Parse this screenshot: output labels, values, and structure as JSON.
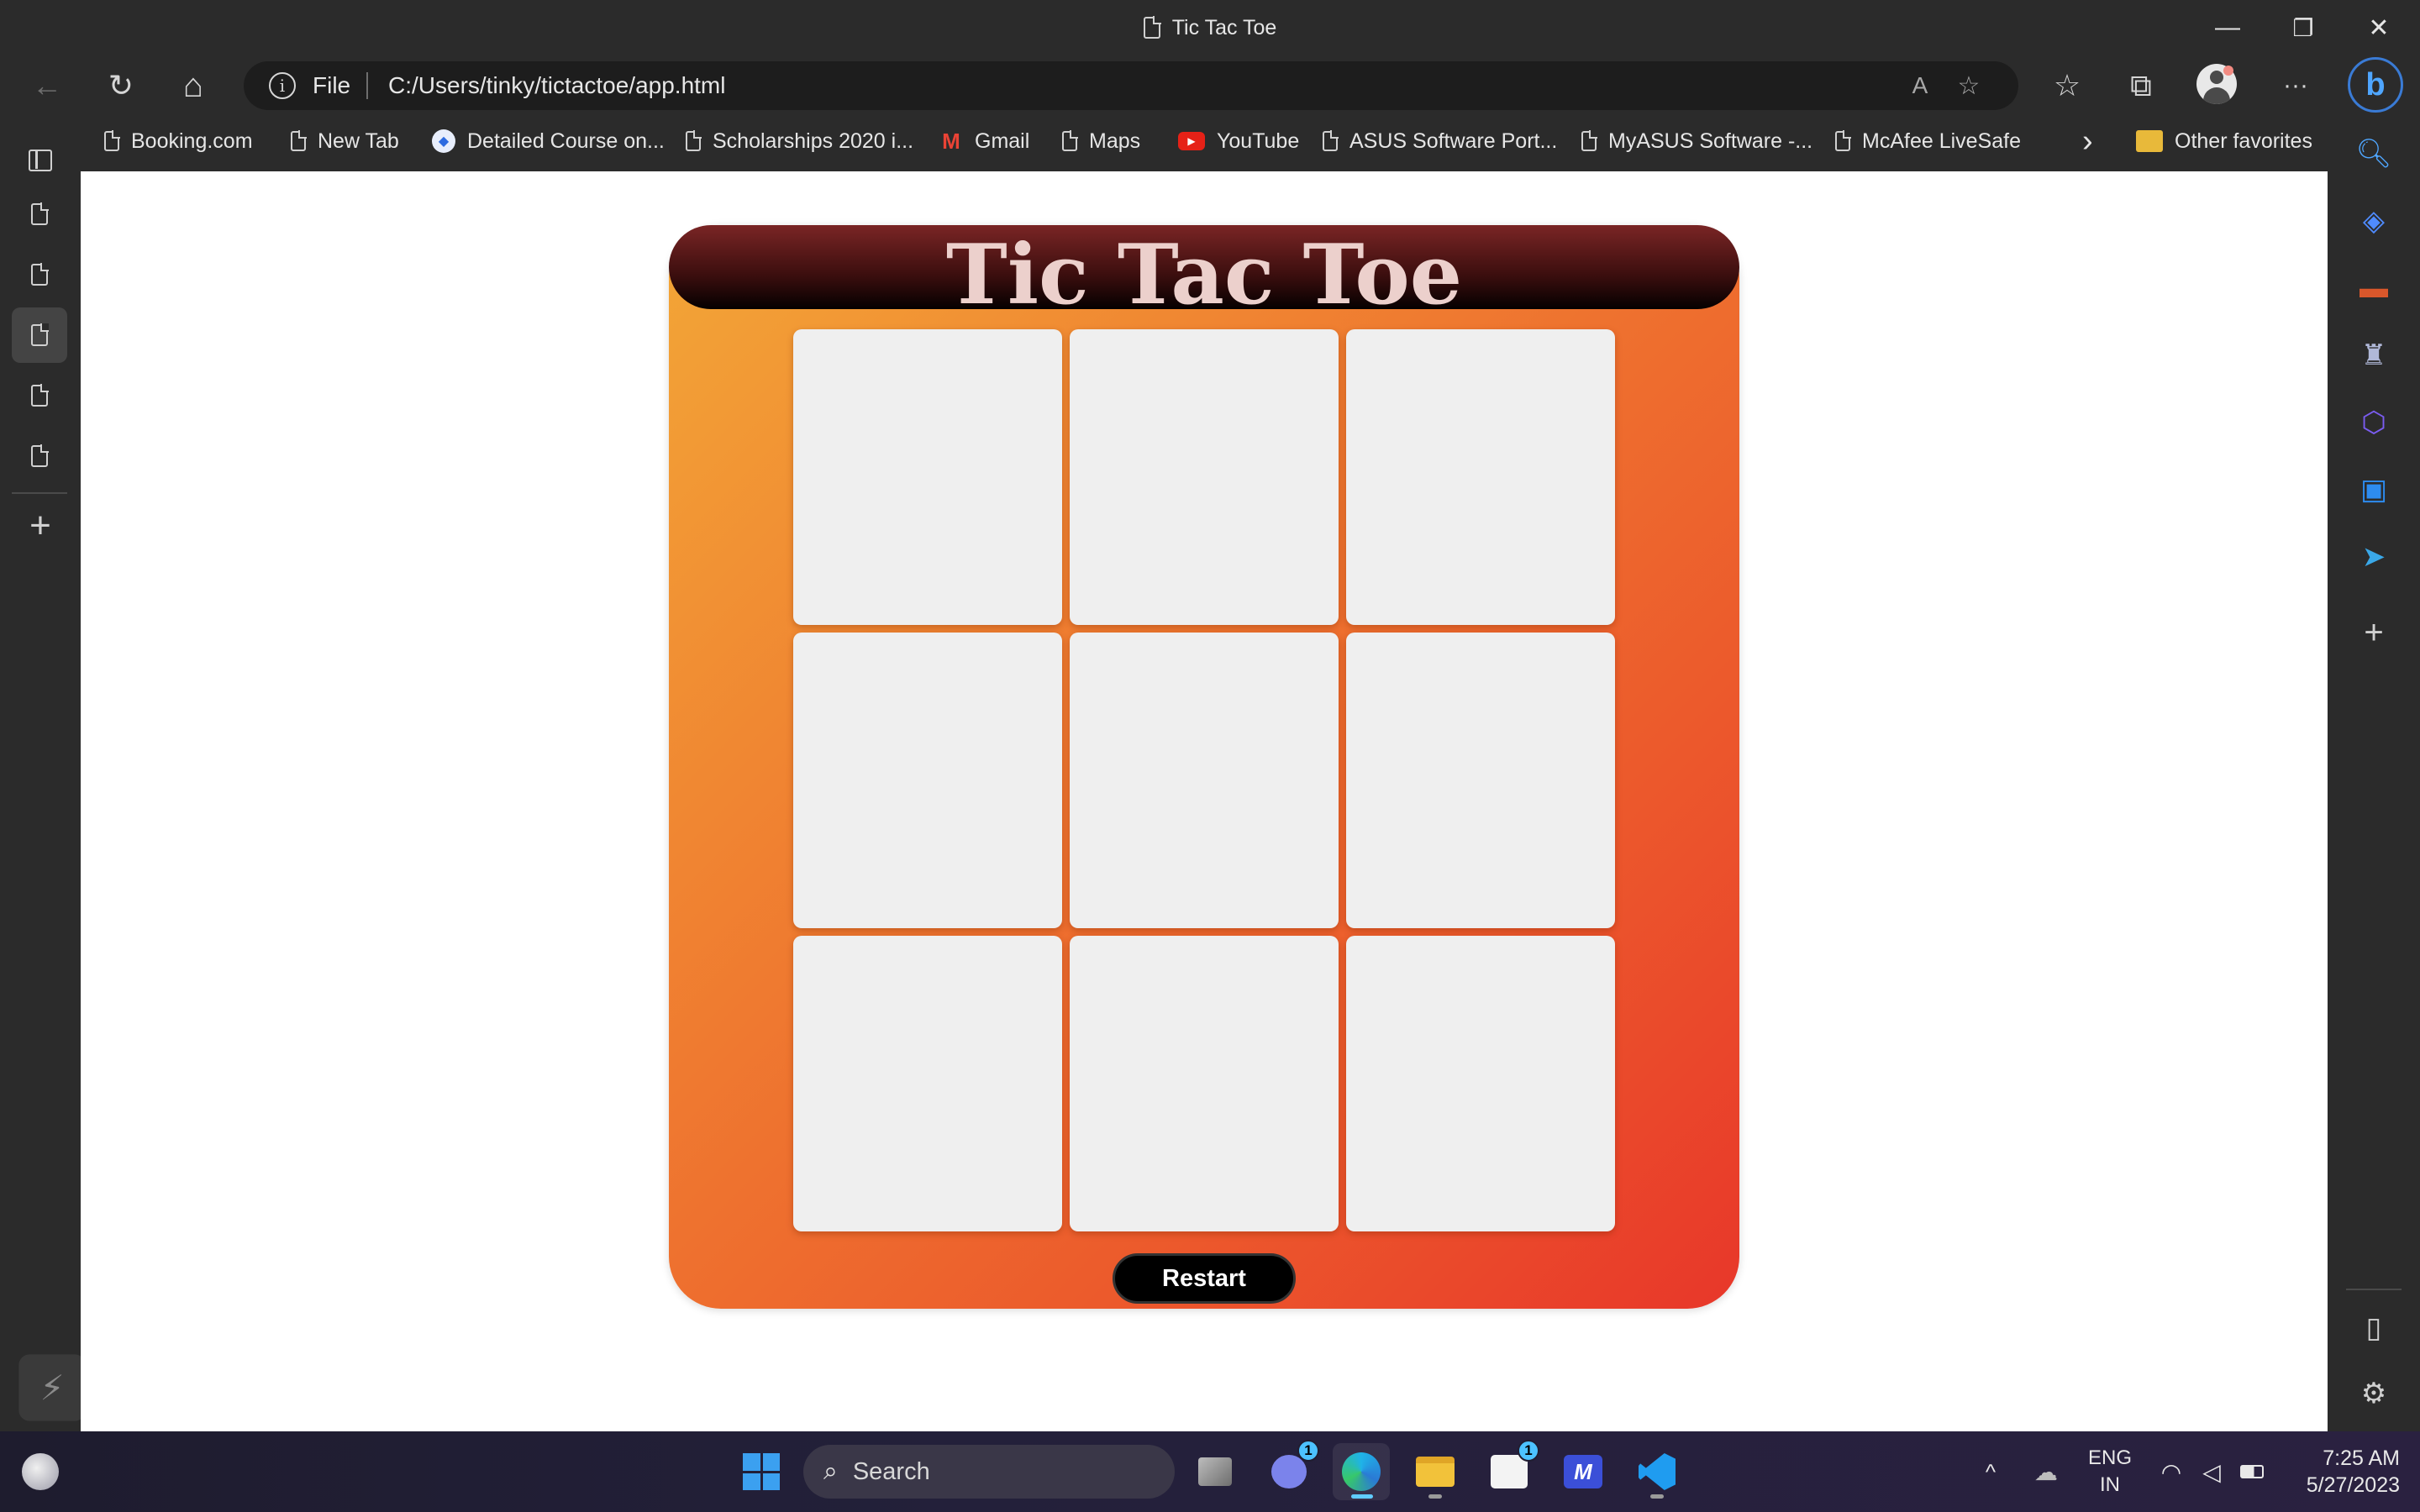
{
  "window": {
    "title": "Tic Tac Toe",
    "controls": {
      "minimize": "—",
      "restore": "❐",
      "close": "✕"
    }
  },
  "toolbar": {
    "back_icon": "←",
    "reload_icon": "↻",
    "home_icon": "⌂",
    "address": {
      "info_icon": "i",
      "scheme_label": "File",
      "url": "C:/Users/tinky/tictactoe/app.html",
      "read_aloud_icon": "A",
      "add_favorite_icon": "☆"
    },
    "favorites_icon": "☆",
    "collections_icon": "⧉",
    "more_icon": "···",
    "copilot_icon": "b"
  },
  "favorites": [
    {
      "label": "Booking.com",
      "icon": "page-icon"
    },
    {
      "label": "New Tab",
      "icon": "page-icon"
    },
    {
      "label": "Detailed Course on...",
      "icon": "course-icon"
    },
    {
      "label": "Scholarships 2020 i...",
      "icon": "page-icon"
    },
    {
      "label": "Gmail",
      "icon": "gmail-icon"
    },
    {
      "label": "Maps",
      "icon": "page-icon"
    },
    {
      "label": "YouTube",
      "icon": "youtube-icon"
    },
    {
      "label": "ASUS Software Port...",
      "icon": "page-icon"
    },
    {
      "label": "MyASUS Software -...",
      "icon": "page-icon"
    },
    {
      "label": "McAfee LiveSafe",
      "icon": "page-icon"
    }
  ],
  "favorites_more_icon": "›",
  "other_favorites": "Other favorites",
  "vertical_tabs": {
    "new_tab_icon": "+",
    "active_index": 3
  },
  "sidebar": {
    "icons": [
      "search-icon",
      "shopping-tag-icon",
      "tools-briefcase-icon",
      "games-chess-icon",
      "microsoft-365-icon",
      "outlook-icon",
      "telegram-icon",
      "add-icon"
    ],
    "add_icon": "+",
    "split_icon": "▯",
    "settings_icon": "⚙"
  },
  "game": {
    "title": "Tic Tac Toe",
    "cells": [
      "",
      "",
      "",
      "",
      "",
      "",
      "",
      "",
      ""
    ],
    "restart_label": "Restart",
    "colors": {
      "gradient_start": "#f3a637",
      "gradient_end": "#e8372a",
      "header": "#3b0e0e",
      "cell": "#efefef"
    }
  },
  "taskbar": {
    "search_placeholder": "Search",
    "apps": [
      {
        "name": "start",
        "badge": ""
      },
      {
        "name": "task-view",
        "badge": ""
      },
      {
        "name": "teams-chat",
        "badge": "1"
      },
      {
        "name": "edge",
        "badge": ""
      },
      {
        "name": "file-explorer",
        "badge": ""
      },
      {
        "name": "microsoft-store",
        "badge": "1"
      },
      {
        "name": "myasus",
        "badge": ""
      },
      {
        "name": "vscode",
        "badge": ""
      }
    ],
    "tray": {
      "chevron_icon": "^",
      "lang_line1": "ENG",
      "lang_line2": "IN",
      "time": "7:25 AM",
      "date": "5/27/2023"
    }
  }
}
